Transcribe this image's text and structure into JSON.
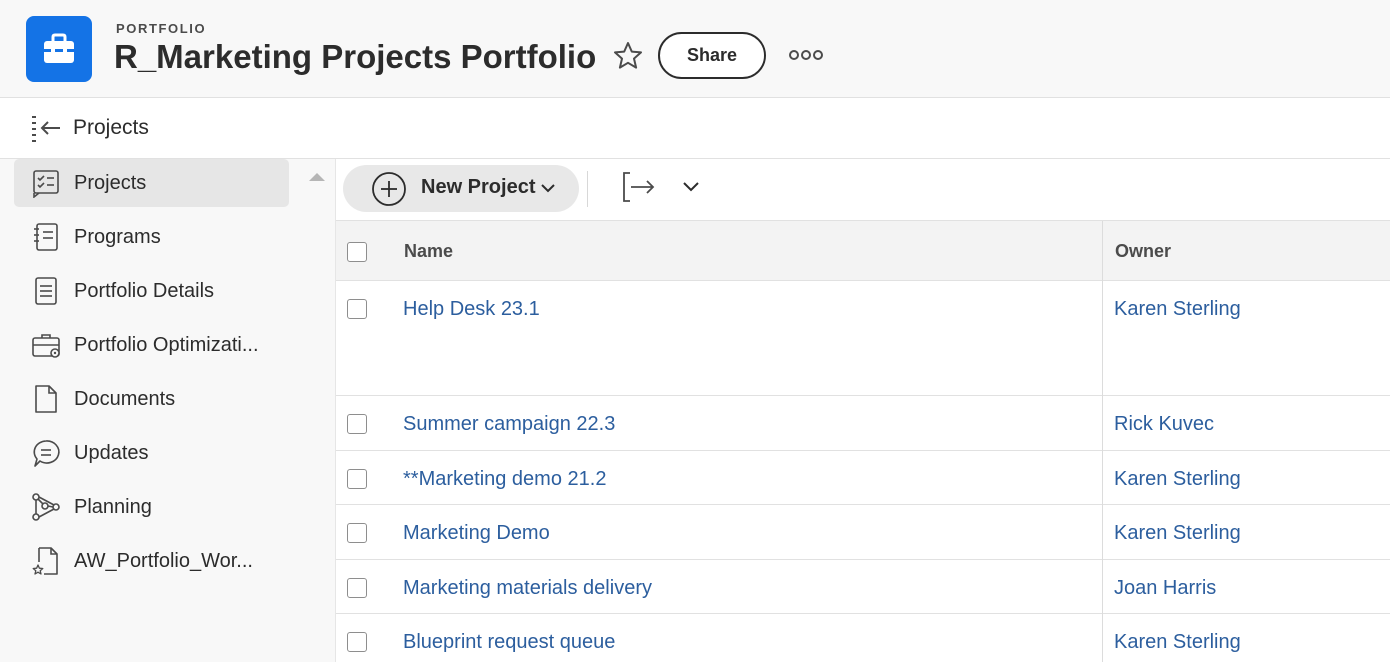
{
  "header": {
    "overline": "PORTFOLIO",
    "title": "R_Marketing Projects Portfolio",
    "share_label": "Share",
    "accent_color": "#1473e6"
  },
  "subheader": {
    "title": "Projects"
  },
  "sidebar": {
    "items": [
      {
        "label": "Projects",
        "icon": "checklist-icon",
        "active": true
      },
      {
        "label": "Programs",
        "icon": "notebook-list-icon"
      },
      {
        "label": "Portfolio Details",
        "icon": "document-lines-icon"
      },
      {
        "label": "Portfolio Optimizati...",
        "icon": "briefcase-gear-icon"
      },
      {
        "label": "Documents",
        "icon": "document-icon"
      },
      {
        "label": "Updates",
        "icon": "chat-bubble-icon"
      },
      {
        "label": "Planning",
        "icon": "nodes-icon"
      },
      {
        "label": "AW_Portfolio_Wor...",
        "icon": "document-star-icon"
      }
    ]
  },
  "toolbar": {
    "new_project_label": "New Project"
  },
  "table": {
    "columns": [
      "Name",
      "Owner"
    ],
    "rows": [
      {
        "name": "Help Desk 23.1",
        "owner": "Karen Sterling"
      },
      {
        "name": "Summer campaign 22.3",
        "owner": "Rick Kuvec"
      },
      {
        "name": "**Marketing demo 21.2",
        "owner": "Karen Sterling"
      },
      {
        "name": "Marketing Demo",
        "owner": "Karen Sterling"
      },
      {
        "name": "Marketing materials delivery",
        "owner": "Joan Harris"
      },
      {
        "name": "Blueprint request queue",
        "owner": "Karen Sterling"
      }
    ]
  }
}
